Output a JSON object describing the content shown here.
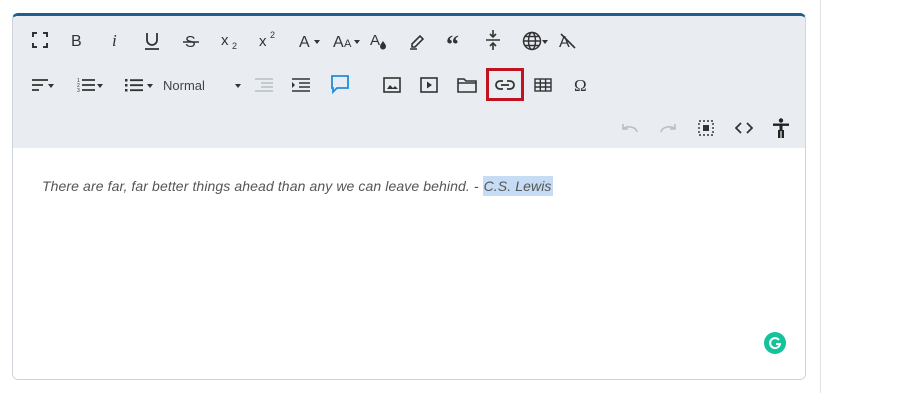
{
  "toolbar": {
    "text_style": "Normal"
  },
  "content": {
    "quote_text": "There are far, far better things ahead than any we can leave behind. - ",
    "selected_text": "C.S. Lewis"
  },
  "colors": {
    "accent": "#1f5f8b",
    "highlight_border": "#c1121f",
    "selection": "#c6dcf4",
    "toolbar_bg": "#e9edf1",
    "comment_icon": "#1a8fe3",
    "grammarly": "#15c39a"
  },
  "icons": [
    "fullscreen-icon",
    "bold-icon",
    "italic-icon",
    "underline-icon",
    "strikethrough-icon",
    "subscript-icon",
    "superscript-icon",
    "font-color-icon",
    "font-size-icon",
    "text-color-drop-icon",
    "highlight-icon",
    "blockquote-icon",
    "line-break-icon",
    "language-icon",
    "clear-format-icon",
    "align-icon",
    "numbered-list-icon",
    "bullet-list-icon",
    "outdent-icon",
    "indent-icon",
    "comment-icon",
    "image-icon",
    "video-icon",
    "folder-icon",
    "link-icon",
    "table-icon",
    "special-char-icon",
    "undo-icon",
    "redo-icon",
    "select-all-icon",
    "source-code-icon",
    "accessibility-icon",
    "grammarly-icon"
  ]
}
